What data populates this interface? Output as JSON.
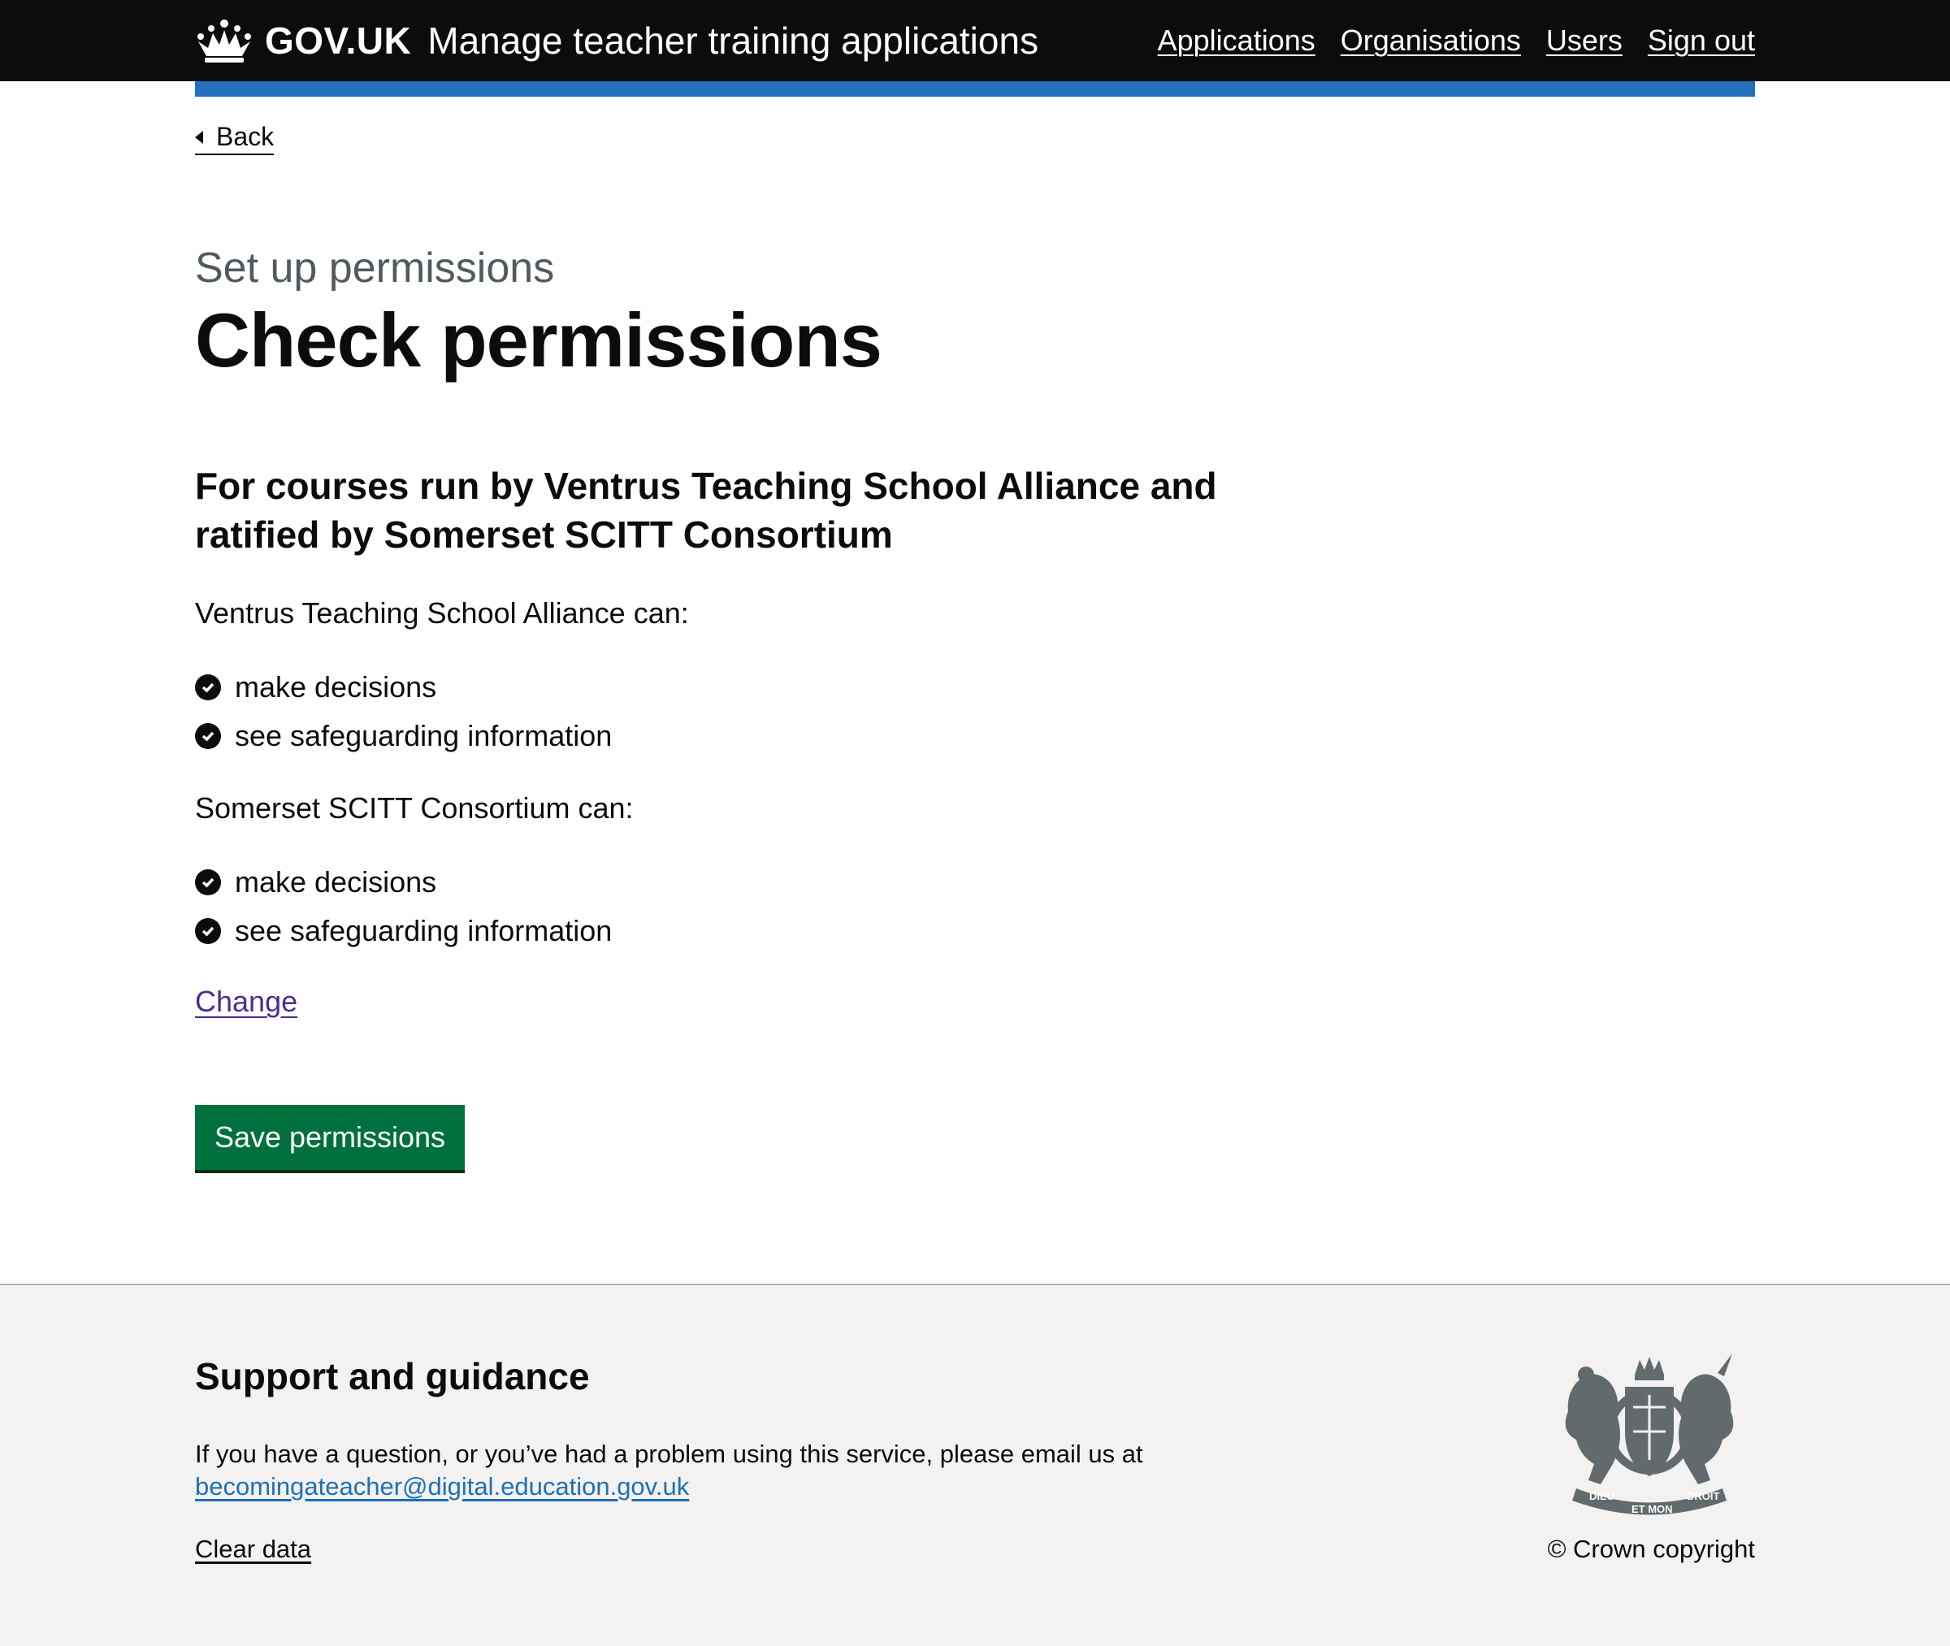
{
  "header": {
    "brand": "GOV.UK",
    "service_name": "Manage teacher training applications",
    "nav": [
      "Applications",
      "Organisations",
      "Users",
      "Sign out"
    ]
  },
  "back_label": "Back",
  "caption": "Set up permissions",
  "title": "Check permissions",
  "subheading": "For courses run by Ventrus Teaching School Alliance and ratified by Somerset SCITT Consortium",
  "groups": [
    {
      "label": "Ventrus Teaching School Alliance can:",
      "items": [
        "make decisions",
        "see safeguarding information"
      ]
    },
    {
      "label": "Somerset SCITT Consortium can:",
      "items": [
        "make decisions",
        "see safeguarding information"
      ]
    }
  ],
  "change_label": "Change",
  "save_label": "Save permissions",
  "footer": {
    "heading": "Support and guidance",
    "text": "If you have a question, or you’ve had a problem using this service, please email us at",
    "email": "becomingateacher@digital.education.gov.uk",
    "clear_data": "Clear data",
    "copyright": "© Crown copyright",
    "crest_motto": [
      "DIEU",
      "ET MON",
      "DROIT"
    ]
  },
  "colors": {
    "header_bg": "#0b0c0c",
    "accent_bar": "#2371bf",
    "button_green": "#00703c",
    "link_visited": "#4c2c92",
    "link": "#1d70b8",
    "footer_bg": "#f3f2f1"
  }
}
